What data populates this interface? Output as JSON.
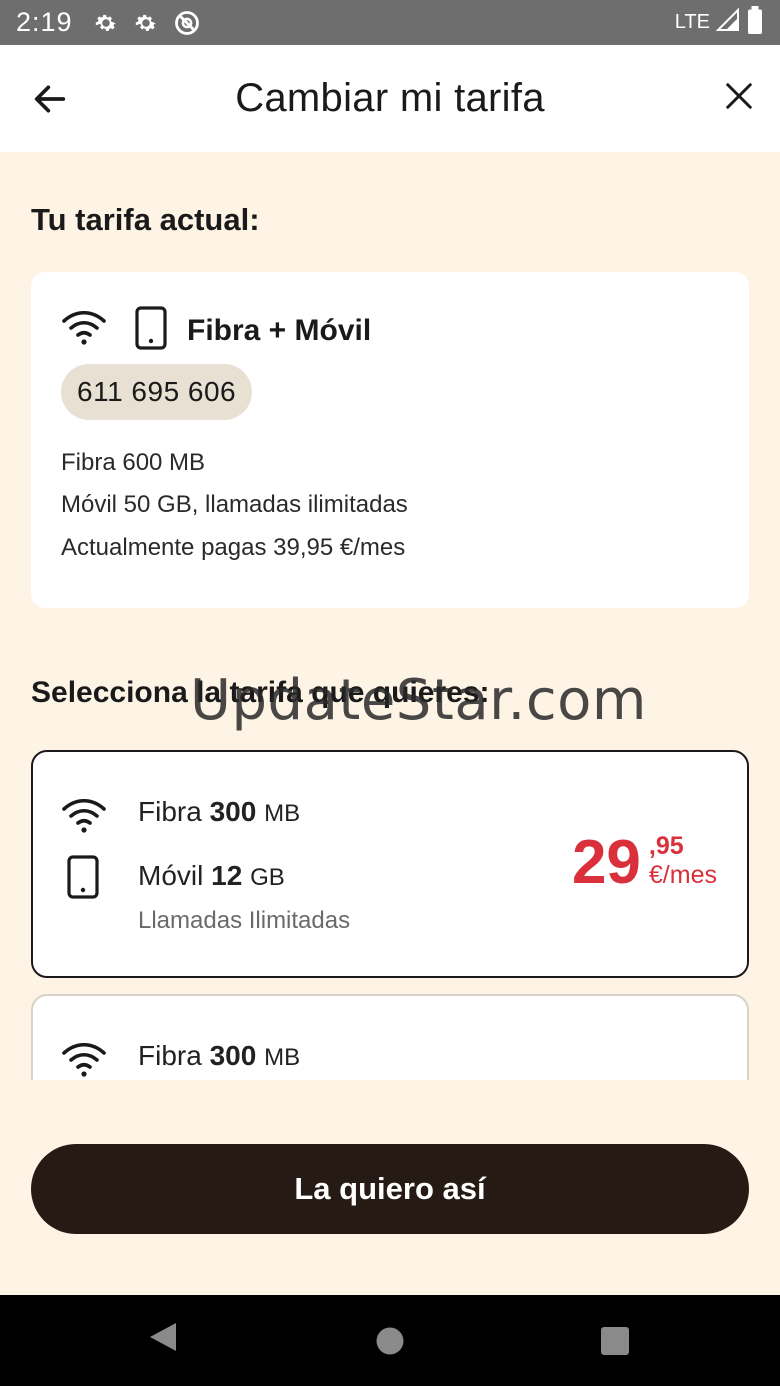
{
  "status_bar": {
    "time": "2:19",
    "network": "LTE",
    "icons": [
      "settings-icon",
      "settings-icon",
      "block-icon",
      "signal-icon",
      "battery-icon"
    ]
  },
  "app_bar": {
    "title": "Cambiar mi tarifa",
    "back_icon": "arrow-left-icon",
    "close_icon": "close-icon"
  },
  "current": {
    "section_title": "Tu tarifa actual:",
    "plan_name": "Fibra + Móvil",
    "phone": "611 695 606",
    "details": [
      "Fibra 600 MB",
      "Móvil 50 GB, llamadas ilimitadas",
      "Actualmente pagas 39,95 €/mes"
    ]
  },
  "watermark": "UpdateStar.com",
  "select": {
    "section_title": "Selecciona la tarifa que quieres:",
    "plans": [
      {
        "fibra_label": "Fibra",
        "fibra_value": "300",
        "fibra_unit": "MB",
        "movil_label": "Móvil",
        "movil_value": "12",
        "movil_unit": "GB",
        "calls": "Llamadas Ilimitadas",
        "price_int": "29",
        "price_cents": ",95",
        "price_per": "€/mes",
        "selected": true
      },
      {
        "fibra_label": "Fibra",
        "fibra_value": "300",
        "fibra_unit": "MB",
        "selected": false
      }
    ]
  },
  "cta": {
    "label": "La quiero así"
  },
  "colors": {
    "accent_price": "#d9303b",
    "background": "#fdf4e6",
    "cta": "#251a14"
  }
}
